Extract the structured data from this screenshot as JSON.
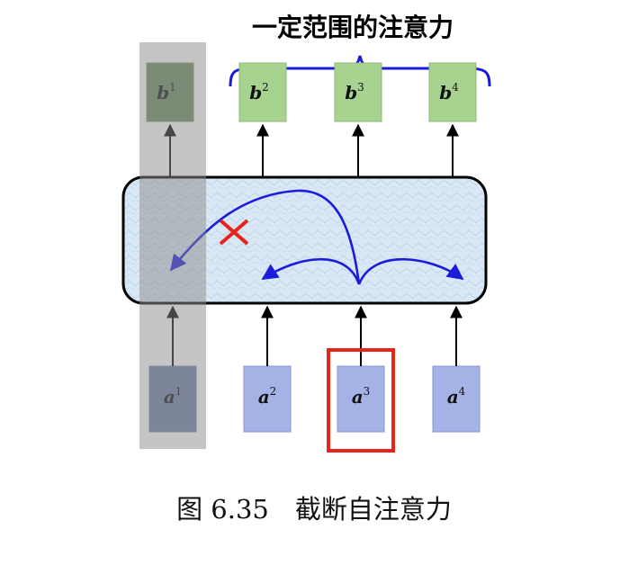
{
  "title": "一定范围的注意力",
  "caption": "图 6.35　截断自注意力",
  "outputs": [
    {
      "base": "b",
      "index": "1"
    },
    {
      "base": "b",
      "index": "2"
    },
    {
      "base": "b",
      "index": "3"
    },
    {
      "base": "b",
      "index": "4"
    }
  ],
  "inputs": [
    {
      "base": "a",
      "index": "1"
    },
    {
      "base": "a",
      "index": "2"
    },
    {
      "base": "a",
      "index": "3"
    },
    {
      "base": "a",
      "index": "4"
    }
  ],
  "colors": {
    "output_box": "#a7d28f",
    "output_box_masked": "#6d8a60",
    "input_box": "#a5b3e6",
    "input_box_masked": "#6f7ea8",
    "attention_arc": "#1b1bdc",
    "highlight": "#e8231d",
    "mask": "#8c8c8c"
  }
}
